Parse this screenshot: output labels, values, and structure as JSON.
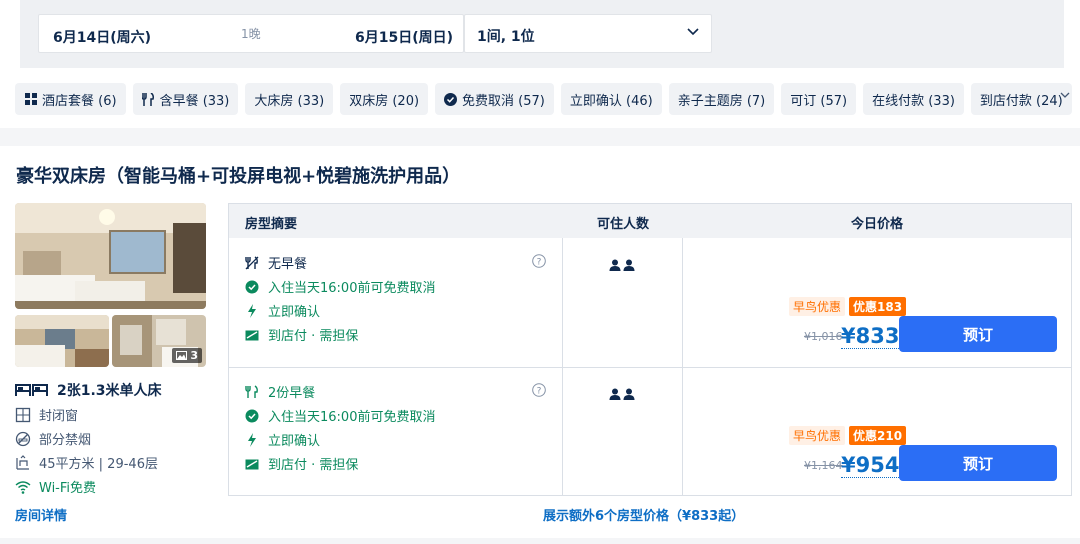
{
  "search": {
    "checkin": "6月14日(周六)",
    "nights": "1晚",
    "checkout": "6月15日(周日)",
    "guests": "1间, 1位"
  },
  "filters": [
    {
      "label": "酒店套餐 (6)",
      "icon": "package-icon"
    },
    {
      "label": "含早餐 (33)",
      "icon": "breakfast-icon"
    },
    {
      "label": "大床房 (33)"
    },
    {
      "label": "双床房 (20)"
    },
    {
      "label": "免费取消 (57)",
      "icon": "check-circle-icon"
    },
    {
      "label": "立即确认 (46)"
    },
    {
      "label": "亲子主题房 (7)"
    },
    {
      "label": "可订 (57)"
    },
    {
      "label": "在线付款 (33)"
    },
    {
      "label": "到店付款 (24)"
    }
  ],
  "room": {
    "title": "豪华双床房（智能马桶+可投屏电视+悦碧施洗护用品）",
    "photo_count": "3",
    "bed": "2张1.3米单人床",
    "amenities": [
      {
        "label": "封闭窗",
        "icon": "window-icon"
      },
      {
        "label": "部分禁烟",
        "icon": "no-smoking-icon"
      },
      {
        "label": "45平方米 | 29-46层",
        "icon": "area-icon"
      },
      {
        "label": "Wi-Fi免费",
        "icon": "wifi-icon"
      }
    ],
    "details_link": "房间详情"
  },
  "table": {
    "headers": [
      "房型摘要",
      "可住人数",
      "今日价格"
    ],
    "rows": [
      {
        "meal": "无早餐",
        "cancel": "入住当天16:00前可免费取消",
        "confirm": "立即确认",
        "payment": "到店付 · 需担保",
        "early_bird": "早鸟优惠",
        "discount": "优惠183",
        "original_price": "¥1,016",
        "price": "¥833",
        "book": "预订"
      },
      {
        "meal": "2份早餐",
        "cancel": "入住当天16:00前可免费取消",
        "confirm": "立即确认",
        "payment": "到店付 · 需担保",
        "early_bird": "早鸟优惠",
        "discount": "优惠210",
        "original_price": "¥1,164",
        "price": "¥954",
        "book": "预订"
      }
    ],
    "more_link": "展示额外6个房型价格（¥833起）"
  },
  "colors": {
    "accent": "#2b6ef5",
    "price": "#0e6ec5",
    "promo": "#ff6f00",
    "green": "#0b8a5e"
  }
}
